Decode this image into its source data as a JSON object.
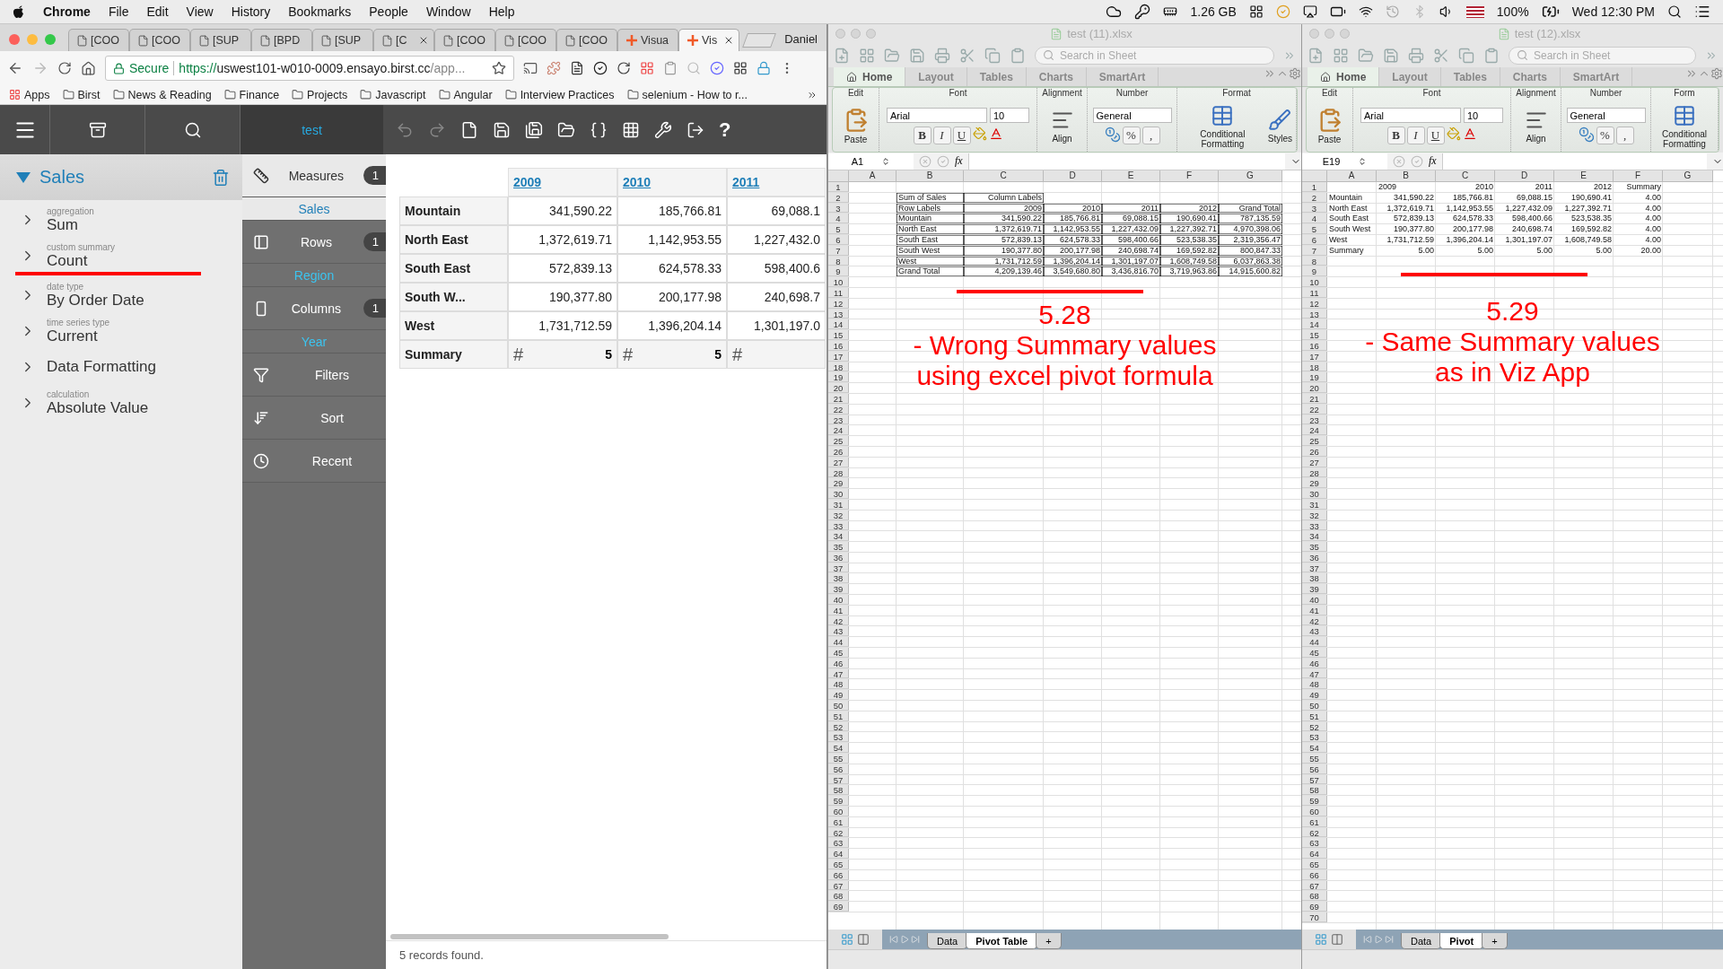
{
  "menu_bar": {
    "app": "Chrome",
    "items": [
      "File",
      "Edit",
      "View",
      "History",
      "Bookmarks",
      "People",
      "Window",
      "Help"
    ],
    "memory": "1.26 GB",
    "battery": "100%",
    "clock": "Wed 12:30 PM"
  },
  "browser": {
    "tabs": [
      {
        "title": "[COO",
        "selected": false,
        "closable": false
      },
      {
        "title": "[COO",
        "selected": false,
        "closable": false
      },
      {
        "title": "[SUP",
        "selected": false,
        "closable": false
      },
      {
        "title": "[BPD",
        "selected": false,
        "closable": false
      },
      {
        "title": "[SUP",
        "selected": false,
        "closable": false
      },
      {
        "title": "[C",
        "selected": false,
        "closable": true
      },
      {
        "title": "[COO",
        "selected": false,
        "closable": false
      },
      {
        "title": "[COO",
        "selected": false,
        "closable": false
      },
      {
        "title": "[COO",
        "selected": false,
        "closable": false
      },
      {
        "title": "Visua",
        "selected": false,
        "closable": false
      },
      {
        "title": "Vis",
        "selected": true,
        "closable": true
      }
    ],
    "profile": "Daniel",
    "secure_label": "Secure",
    "url_scheme": "https://",
    "url_host": "uswest101-w010-0009.ensayo.birst.cc",
    "url_path": "/app...",
    "bookmarks": [
      "Apps",
      "Birst",
      "News & Reading",
      "Finance",
      "Projects",
      "Javascript",
      "Angular",
      "Interview Practices",
      "selenium - How to r..."
    ]
  },
  "app": {
    "toolbar_tab": "test",
    "help_label": "?",
    "measure": {
      "title": "Sales",
      "properties": [
        {
          "caption": "aggregation",
          "value": "Sum",
          "underlined": false
        },
        {
          "caption": "custom summary",
          "value": "Count",
          "underlined": true
        },
        {
          "caption": "date type",
          "value": "By Order Date",
          "underlined": false
        },
        {
          "caption": "time series type",
          "value": "Current",
          "underlined": false
        },
        {
          "value": "Data Formatting",
          "underlined": false
        },
        {
          "caption": "calculation",
          "value": "Absolute Value",
          "underlined": false
        }
      ]
    },
    "shelves": [
      {
        "kind": "measures",
        "label": "Measures",
        "count": "1",
        "value": "Sales",
        "selected": true
      },
      {
        "kind": "rows",
        "label": "Rows",
        "count": "1",
        "value": "Region",
        "selected": false
      },
      {
        "kind": "columns",
        "label": "Columns",
        "count": "1",
        "value": "Year",
        "selected": false
      },
      {
        "kind": "filters",
        "label": "Filters",
        "selected": false
      },
      {
        "kind": "sort",
        "label": "Sort",
        "selected": false
      },
      {
        "kind": "recent",
        "label": "Recent",
        "selected": false
      }
    ],
    "table": {
      "columns": [
        "2009",
        "2010",
        "2011"
      ],
      "rows": [
        {
          "label": "Mountain",
          "values": [
            "341,590.22",
            "185,766.81",
            "69,088.1"
          ]
        },
        {
          "label": "North East",
          "values": [
            "1,372,619.71",
            "1,142,953.55",
            "1,227,432.0"
          ]
        },
        {
          "label": "South East",
          "values": [
            "572,839.13",
            "624,578.33",
            "598,400.6"
          ]
        },
        {
          "label": "South W...",
          "values": [
            "190,377.80",
            "200,177.98",
            "240,698.7"
          ]
        },
        {
          "label": "West",
          "values": [
            "1,731,712.59",
            "1,396,204.14",
            "1,301,197.0"
          ]
        }
      ],
      "summary": {
        "label": "Summary",
        "cells": [
          {
            "symbol": "#",
            "value": "5"
          },
          {
            "symbol": "#",
            "value": "5"
          },
          {
            "symbol": "#"
          }
        ]
      }
    },
    "status": "5 records found."
  },
  "excel_windows": [
    {
      "title": "test (11).xlsx",
      "search_placeholder": "Search in Sheet",
      "tabs": [
        {
          "label": "Home",
          "selected": true
        },
        {
          "label": "Layout",
          "selected": false
        },
        {
          "label": "Tables",
          "selected": false
        },
        {
          "label": "Charts",
          "selected": false
        },
        {
          "label": "SmartArt",
          "selected": false
        }
      ],
      "ribbon_groups": [
        {
          "kind": "edit",
          "label": "Edit",
          "button": "Paste"
        },
        {
          "kind": "font",
          "label": "Font",
          "font": "Arial",
          "size": "10",
          "styles": [
            "B",
            "I",
            "U"
          ]
        },
        {
          "kind": "alignment",
          "label": "Alignment",
          "button": "Align"
        },
        {
          "kind": "number",
          "label": "Number",
          "format": "General",
          "symbols": [
            "%",
            ","
          ]
        },
        {
          "kind": "format",
          "label": "Format",
          "buttons": [
            "Conditional Formatting",
            "Styles"
          ]
        }
      ],
      "name_box": "A1",
      "fx": "fx",
      "columns": [
        "A",
        "B",
        "C",
        "D",
        "E",
        "F",
        "G"
      ],
      "table_borders": true,
      "rows": [
        {
          "number": "1"
        },
        {
          "number": "2",
          "cells": [
            null,
            "Sum of Sales",
            "Column Labels",
            null,
            null,
            null,
            null
          ]
        },
        {
          "number": "3",
          "cells": [
            null,
            "Row Labels",
            "2009",
            "2010",
            "2011",
            "2012",
            "Grand Total"
          ]
        },
        {
          "number": "4",
          "cells": [
            null,
            "Mountain",
            "341,590.22",
            "185,766.81",
            "69,088.15",
            "190,690.41",
            "787,135.59"
          ]
        },
        {
          "number": "5",
          "cells": [
            null,
            "North East",
            "1,372,619.71",
            "1,142,953.55",
            "1,227,432.09",
            "1,227,392.71",
            "4,970,398.06"
          ]
        },
        {
          "number": "6",
          "cells": [
            null,
            "South East",
            "572,839.13",
            "624,578.33",
            "598,400.66",
            "523,538.35",
            "2,319,356.47"
          ]
        },
        {
          "number": "7",
          "cells": [
            null,
            "South West",
            "190,377.80",
            "200,177.98",
            "240,698.74",
            "169,592.82",
            "800,847.33"
          ]
        },
        {
          "number": "8",
          "cells": [
            null,
            "West",
            "1,731,712.59",
            "1,396,204.14",
            "1,301,197.07",
            "1,608,749.58",
            "6,037,863.38"
          ]
        },
        {
          "number": "9",
          "cells": [
            null,
            "Grand Total",
            "4,209,139.46",
            "3,549,680.80",
            "3,436,816.70",
            "3,719,963.86",
            "14,915,600.82"
          ]
        },
        {
          "number": "10"
        },
        {
          "number": "11"
        },
        {
          "number": "12"
        },
        {
          "number": "13"
        },
        {
          "number": "14"
        },
        {
          "number": "15"
        },
        {
          "number": "16"
        },
        {
          "number": "17"
        },
        {
          "number": "18"
        },
        {
          "number": "19"
        },
        {
          "number": "20"
        },
        {
          "number": "21"
        },
        {
          "number": "22"
        },
        {
          "number": "23"
        },
        {
          "number": "24"
        },
        {
          "number": "25"
        },
        {
          "number": "26"
        },
        {
          "number": "27"
        },
        {
          "number": "28"
        },
        {
          "number": "29"
        },
        {
          "number": "30"
        },
        {
          "number": "31"
        },
        {
          "number": "32"
        },
        {
          "number": "33"
        },
        {
          "number": "34"
        },
        {
          "number": "35"
        },
        {
          "number": "36"
        },
        {
          "number": "37"
        },
        {
          "number": "38"
        },
        {
          "number": "39"
        },
        {
          "number": "40"
        },
        {
          "number": "41"
        },
        {
          "number": "42"
        },
        {
          "number": "43"
        },
        {
          "number": "44"
        },
        {
          "number": "45"
        },
        {
          "number": "46"
        },
        {
          "number": "47"
        },
        {
          "number": "48"
        },
        {
          "number": "49"
        },
        {
          "number": "50"
        },
        {
          "number": "51"
        },
        {
          "number": "52"
        },
        {
          "number": "53"
        },
        {
          "number": "54"
        },
        {
          "number": "55"
        },
        {
          "number": "56"
        },
        {
          "number": "57"
        },
        {
          "number": "58"
        },
        {
          "number": "59"
        },
        {
          "number": "60"
        },
        {
          "number": "61"
        },
        {
          "number": "62"
        },
        {
          "number": "63"
        },
        {
          "number": "64"
        },
        {
          "number": "65"
        },
        {
          "number": "66"
        },
        {
          "number": "67"
        },
        {
          "number": "68"
        },
        {
          "number": "69"
        }
      ],
      "annotation": {
        "title": "5.28",
        "lines": [
          "- Wrong Summary values",
          "using excel pivot formula"
        ]
      },
      "sheet_tabs": [
        {
          "label": "Data",
          "selected": false
        },
        {
          "label": "Pivot Table",
          "selected": true
        }
      ],
      "add_sheet": "+"
    },
    {
      "title": "test (12).xlsx",
      "search_placeholder": "Search in Sheet",
      "tabs": [
        {
          "label": "Home",
          "selected": true
        },
        {
          "label": "Layout",
          "selected": false
        },
        {
          "label": "Tables",
          "selected": false
        },
        {
          "label": "Charts",
          "selected": false
        },
        {
          "label": "SmartArt",
          "selected": false
        }
      ],
      "ribbon_groups": [
        {
          "kind": "edit",
          "label": "Edit",
          "button": "Paste"
        },
        {
          "kind": "font",
          "label": "Font",
          "font": "Arial",
          "size": "10",
          "styles": [
            "B",
            "I",
            "U"
          ]
        },
        {
          "kind": "alignment",
          "label": "Alignment",
          "button": "Align"
        },
        {
          "kind": "number",
          "label": "Number",
          "format": "General",
          "symbols": [
            "%",
            ","
          ]
        },
        {
          "kind": "format",
          "label": "Form",
          "buttons": [
            "Conditional Formatting"
          ]
        }
      ],
      "name_box": "E19",
      "fx": "fx",
      "columns": [
        "A",
        "B",
        "C",
        "D",
        "E",
        "F",
        "G"
      ],
      "table_borders": false,
      "rows": [
        {
          "number": "1",
          "cells": [
            null,
            "2009",
            "2010",
            "2011",
            "2012",
            "Summary",
            null
          ]
        },
        {
          "number": "2",
          "cells": [
            "Mountain",
            "341,590.22",
            "185,766.81",
            "69,088.15",
            "190,690.41",
            "4.00",
            null
          ]
        },
        {
          "number": "3",
          "cells": [
            "North East",
            "1,372,619.71",
            "1,142,953.55",
            "1,227,432.09",
            "1,227,392.71",
            "4.00",
            null
          ]
        },
        {
          "number": "4",
          "cells": [
            "South East",
            "572,839.13",
            "624,578.33",
            "598,400.66",
            "523,538.35",
            "4.00",
            null
          ]
        },
        {
          "number": "5",
          "cells": [
            "South West",
            "190,377.80",
            "200,177.98",
            "240,698.74",
            "169,592.82",
            "4.00",
            null
          ]
        },
        {
          "number": "6",
          "cells": [
            "West",
            "1,731,712.59",
            "1,396,204.14",
            "1,301,197.07",
            "1,608,749.58",
            "4.00",
            null
          ]
        },
        {
          "number": "7",
          "cells": [
            "Summary",
            "5.00",
            "5.00",
            "5.00",
            "5.00",
            "20.00",
            null
          ]
        },
        {
          "number": "8"
        },
        {
          "number": "9"
        },
        {
          "number": "10"
        },
        {
          "number": "11"
        },
        {
          "number": "12"
        },
        {
          "number": "13"
        },
        {
          "number": "14"
        },
        {
          "number": "15"
        },
        {
          "number": "16"
        },
        {
          "number": "17"
        },
        {
          "number": "18"
        },
        {
          "number": "19"
        },
        {
          "number": "20"
        },
        {
          "number": "21"
        },
        {
          "number": "22"
        },
        {
          "number": "23"
        },
        {
          "number": "24"
        },
        {
          "number": "25"
        },
        {
          "number": "26"
        },
        {
          "number": "27"
        },
        {
          "number": "28"
        },
        {
          "number": "29"
        },
        {
          "number": "30"
        },
        {
          "number": "31"
        },
        {
          "number": "32"
        },
        {
          "number": "33"
        },
        {
          "number": "34"
        },
        {
          "number": "35"
        },
        {
          "number": "36"
        },
        {
          "number": "37"
        },
        {
          "number": "38"
        },
        {
          "number": "39"
        },
        {
          "number": "40"
        },
        {
          "number": "41"
        },
        {
          "number": "42"
        },
        {
          "number": "43"
        },
        {
          "number": "44"
        },
        {
          "number": "45"
        },
        {
          "number": "46"
        },
        {
          "number": "47"
        },
        {
          "number": "48"
        },
        {
          "number": "49"
        },
        {
          "number": "50"
        },
        {
          "number": "51"
        },
        {
          "number": "52"
        },
        {
          "number": "53"
        },
        {
          "number": "54"
        },
        {
          "number": "55"
        },
        {
          "number": "56"
        },
        {
          "number": "57"
        },
        {
          "number": "58"
        },
        {
          "number": "59"
        },
        {
          "number": "60"
        },
        {
          "number": "61"
        },
        {
          "number": "62"
        },
        {
          "number": "63"
        },
        {
          "number": "64"
        },
        {
          "number": "65"
        },
        {
          "number": "66"
        },
        {
          "number": "67"
        },
        {
          "number": "68"
        },
        {
          "number": "69"
        },
        {
          "number": "70"
        }
      ],
      "annotation": {
        "title": "5.29",
        "lines": [
          "- Same Summary values",
          "as in Viz App"
        ]
      },
      "sheet_tabs": [
        {
          "label": "Data",
          "selected": false
        },
        {
          "label": "Pivot",
          "selected": true
        }
      ],
      "add_sheet": "+"
    }
  ]
}
